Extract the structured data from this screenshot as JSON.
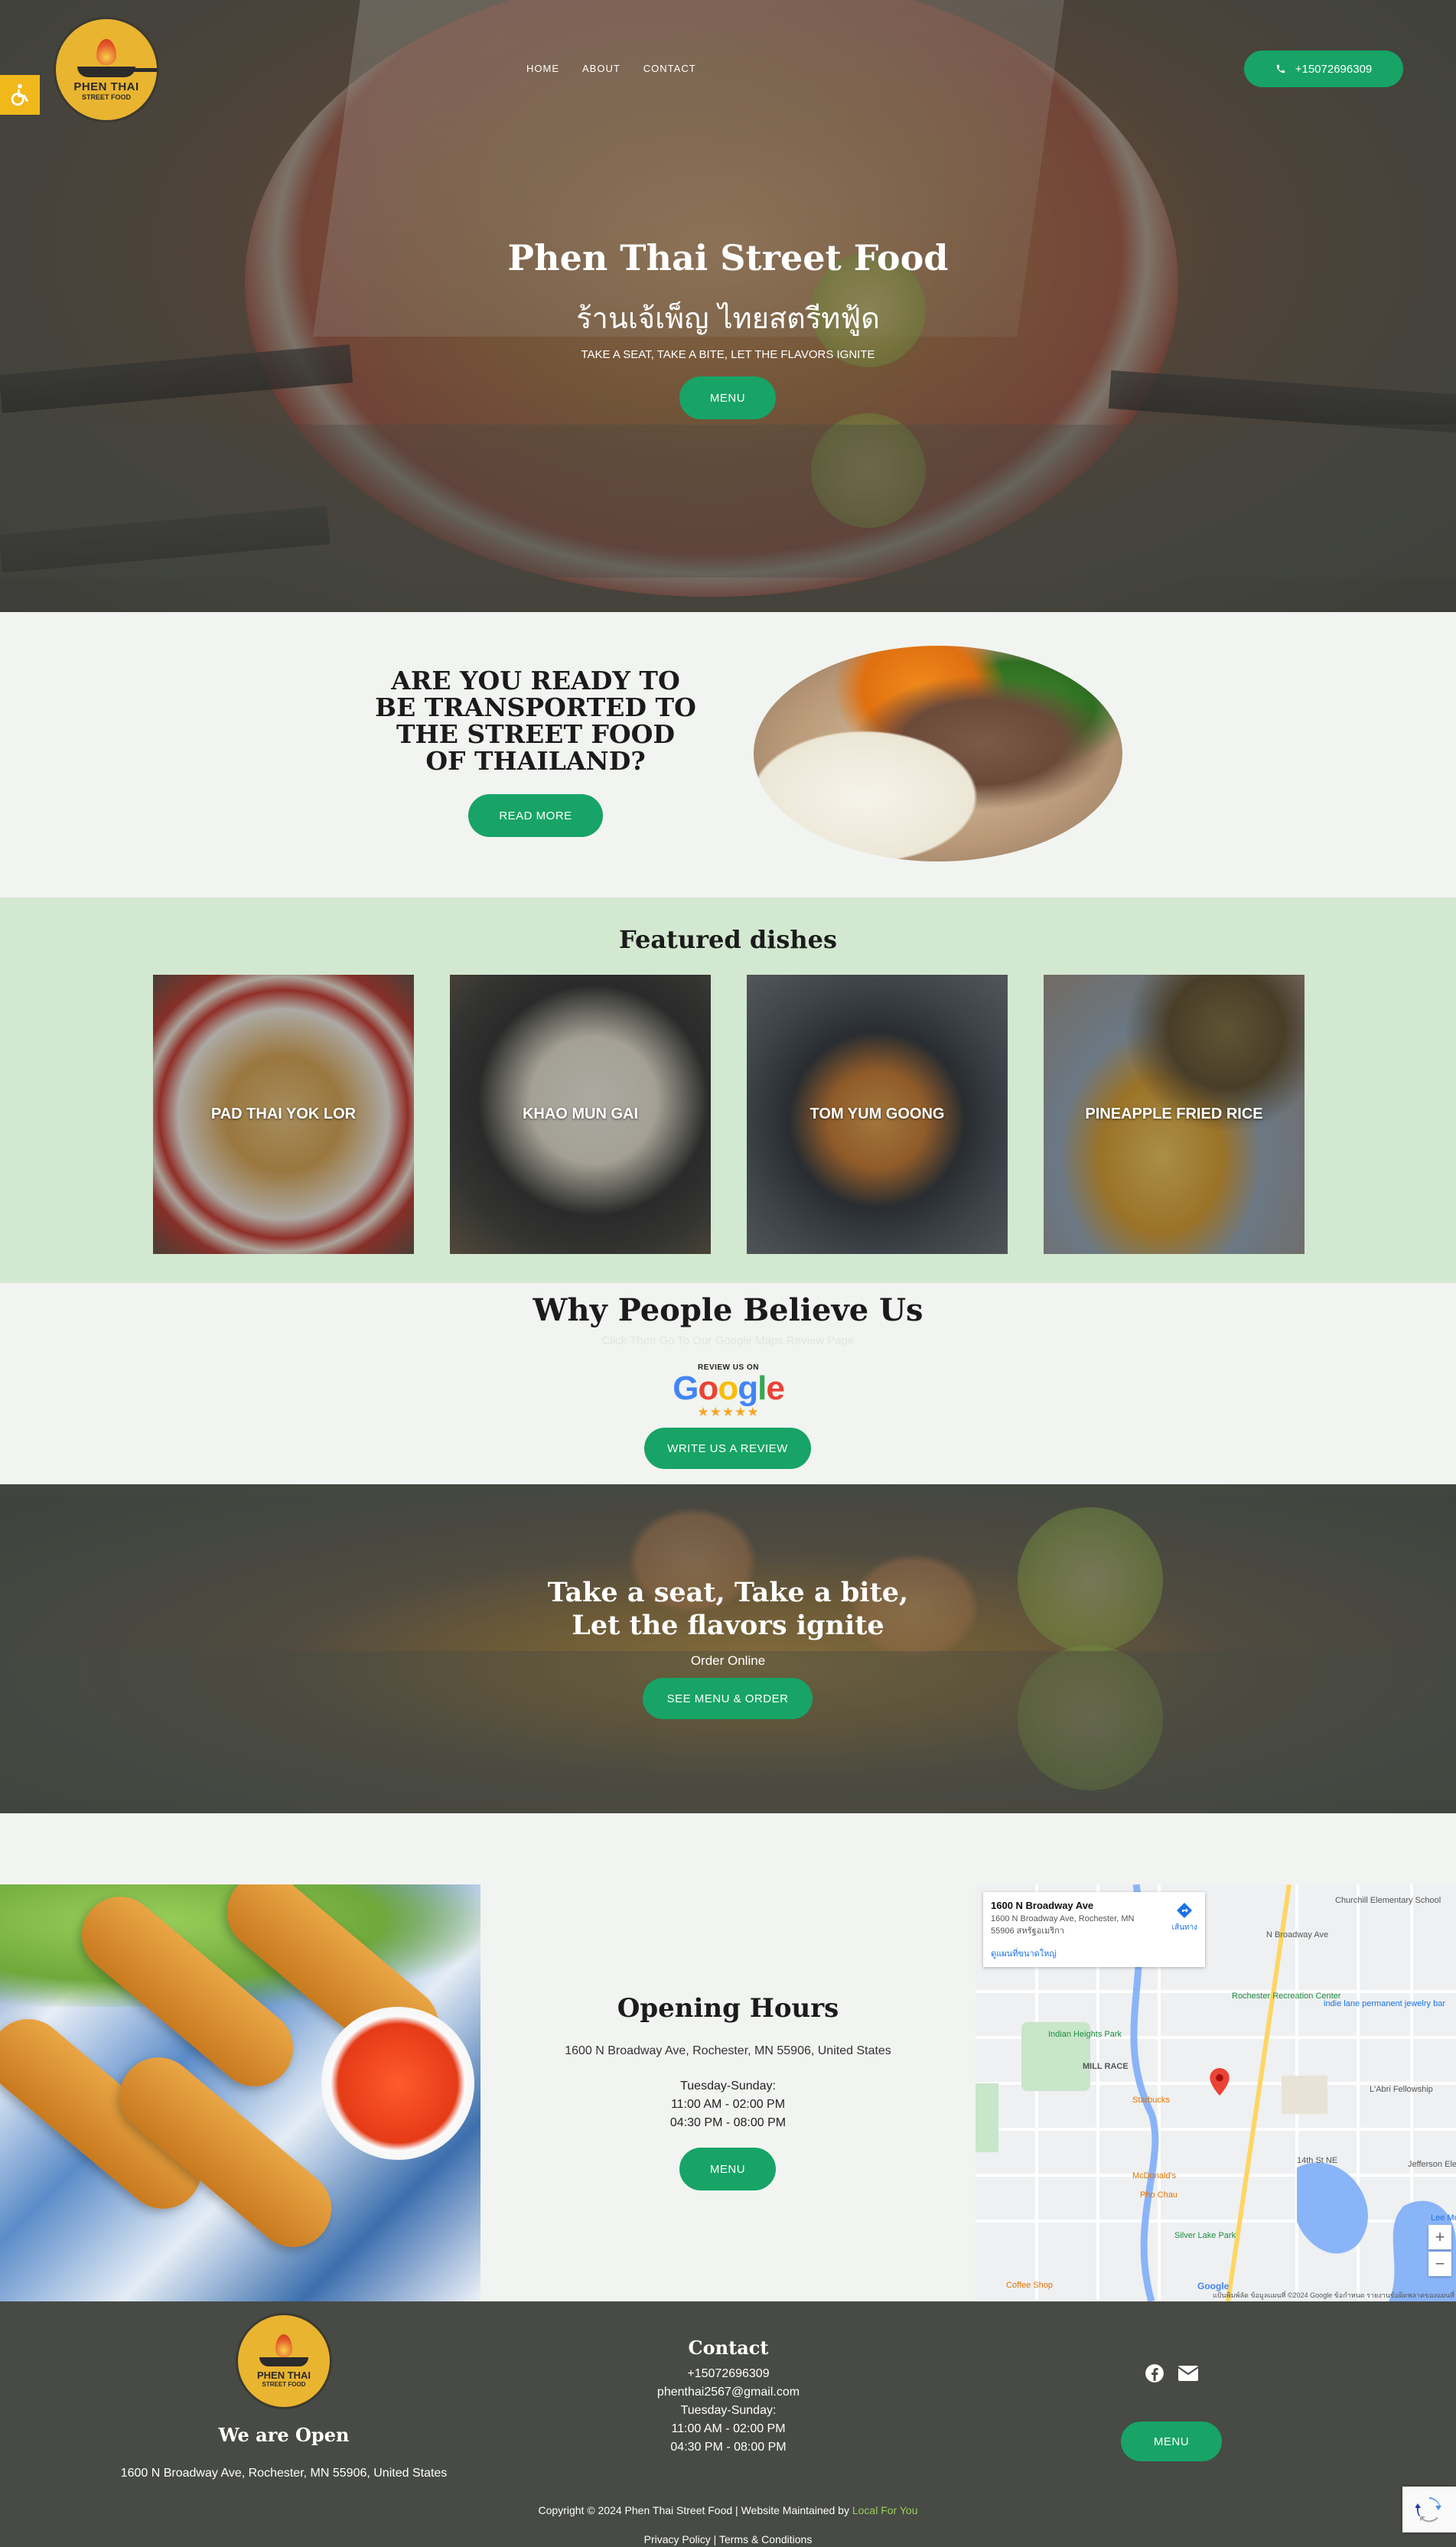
{
  "brand": {
    "logo_line1": "PHEN THAI",
    "logo_line2": "STREET FOOD",
    "accent_color": "#17a466",
    "dark_color": "#474a45",
    "featured_bg": "#d3e8d0"
  },
  "header": {
    "accessibility_icon": "wheelchair-icon",
    "nav": [
      "HOME",
      "ABOUT",
      "CONTACT"
    ],
    "phone": "+15072696309"
  },
  "hero": {
    "title": "Phen Thai Street Food",
    "thai_title": "ร้านเจ้เพ็ญ ไทยสตรีทฟู้ด",
    "tagline": "TAKE A SEAT, TAKE A BITE, LET THE FLAVORS IGNITE",
    "menu_button": "MENU"
  },
  "intro": {
    "heading": "ARE YOU READY TO BE TRANSPORTED TO THE STREET FOOD OF THAILAND?",
    "button": "READ MORE"
  },
  "featured": {
    "title": "Featured dishes",
    "dishes": [
      "PAD THAI YOK LOR",
      "KHAO MUN GAI",
      "TOM YUM GOONG",
      "PINEAPPLE FRIED RICE"
    ]
  },
  "reviews": {
    "title": "Why People Believe Us",
    "faint_text": "Click Then Go To Our Google Maps Review Page",
    "google_small": "REVIEW US ON",
    "google_word": "Google",
    "stars": "★★★★★",
    "button": "WRITE US A REVIEW"
  },
  "cta": {
    "title_line1": "Take a seat, Take a bite,",
    "title_line2": "Let the flavors ignite",
    "subtitle": "Order Online",
    "button": "SEE MENU & ORDER"
  },
  "hours": {
    "title": "Opening Hours",
    "address": "1600 N Broadway Ave, Rochester, MN 55906, United States",
    "days": "Tuesday-Sunday:",
    "slot1": "11:00 AM - 02:00 PM",
    "slot2": "04:30 PM - 08:00 PM",
    "button": "MENU"
  },
  "map": {
    "place": "1600 N Broadway Ave",
    "place_address": "1600 N Broadway Ave, Rochester, MN 55906 สหรัฐอเมริกา",
    "larger_map": "ดูแผนที่ขนาดใหญ่",
    "directions": "เส้นทาง",
    "labels": [
      "Churchill Elementary School",
      "Rochester Recreation Center",
      "indie lane permanent jewelry bar",
      "Indian Heights Park",
      "MILL RACE",
      "L'Abri Fellowship",
      "Starbucks",
      "McDonald's",
      "Pho Chau",
      "Silver Lake Park",
      "Jefferson Elementary School",
      "14th St NE",
      "N Broadway Ave",
      "Lee Mo",
      "Coffee Shop"
    ],
    "footer_text": "แป้นพิมพ์ลัด   ข้อมูลแผนที่ ©2024 Google   ข้อกำหนด   รายงานข้อผิดพลาดของแผนที่",
    "google": "Google"
  },
  "footer": {
    "open_title": "We are Open",
    "address": "1600 N Broadway Ave, Rochester, MN 55906, United States",
    "contact_title": "Contact",
    "phone": "+15072696309",
    "email": "phenthai2567@gmail.com",
    "days": "Tuesday-Sunday:",
    "slot1": "11:00 AM - 02:00 PM",
    "slot2": "04:30 PM - 08:00 PM",
    "menu_button": "MENU",
    "copyright": "Copyright © 2024 Phen Thai Street Food | Website Maintained by ",
    "maintainer": "Local For You",
    "privacy": "Privacy Policy",
    "terms": "Terms & Conditions",
    "social_icons": [
      "facebook-icon",
      "envelope-icon"
    ]
  }
}
